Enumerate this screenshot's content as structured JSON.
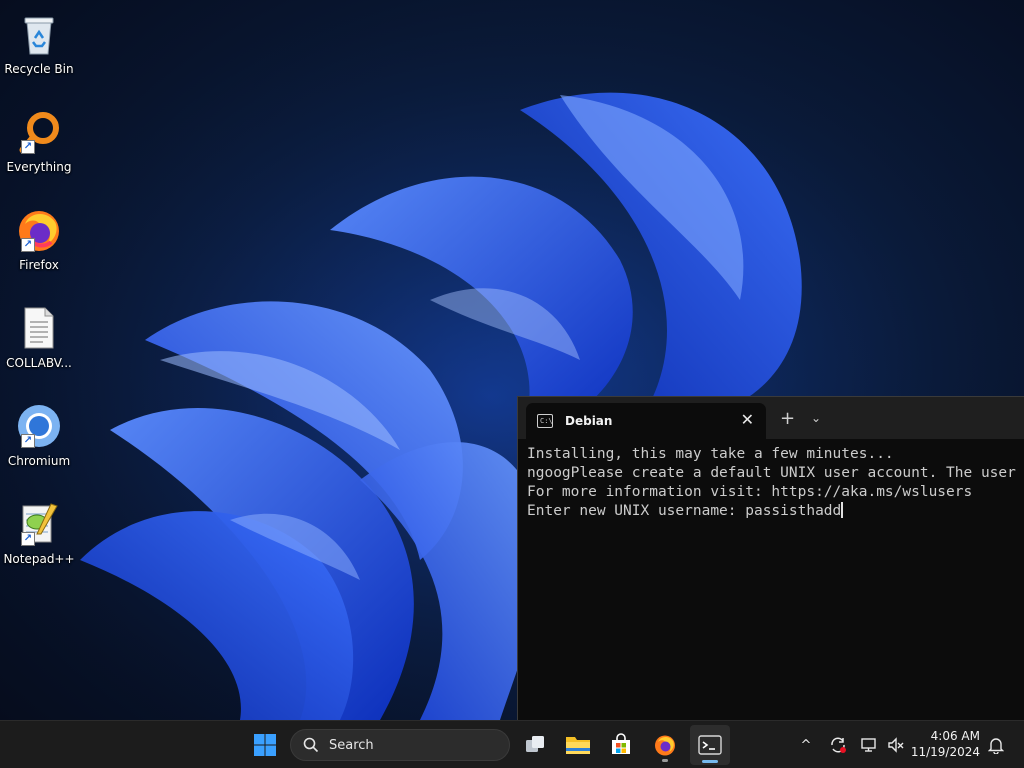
{
  "desktop": {
    "icons": [
      {
        "label": "Recycle Bin"
      },
      {
        "label": "Everything"
      },
      {
        "label": "Firefox"
      },
      {
        "label": "COLLABV..."
      },
      {
        "label": "Chromium"
      },
      {
        "label": "Notepad++"
      }
    ]
  },
  "terminal": {
    "tab_title": "Debian",
    "tab_icon_text": "C:\\",
    "close_glyph": "✕",
    "new_tab_glyph": "+",
    "dropdown_glyph": "⌄",
    "lines": [
      "Installing, this may take a few minutes...",
      "ngoogPlease create a default UNIX user account. The user",
      "For more information visit: https://aka.ms/wslusers",
      "Enter new UNIX username: passisthadd"
    ]
  },
  "taskbar": {
    "search_label": "Search",
    "clock_time": "4:06 AM",
    "clock_date": "11/19/2024",
    "tray_chevron": "^"
  },
  "colors": {
    "accent": "#76b9ed",
    "terminal_bg": "#0c0c0c",
    "taskbar_bg": "#1c1c1c"
  }
}
